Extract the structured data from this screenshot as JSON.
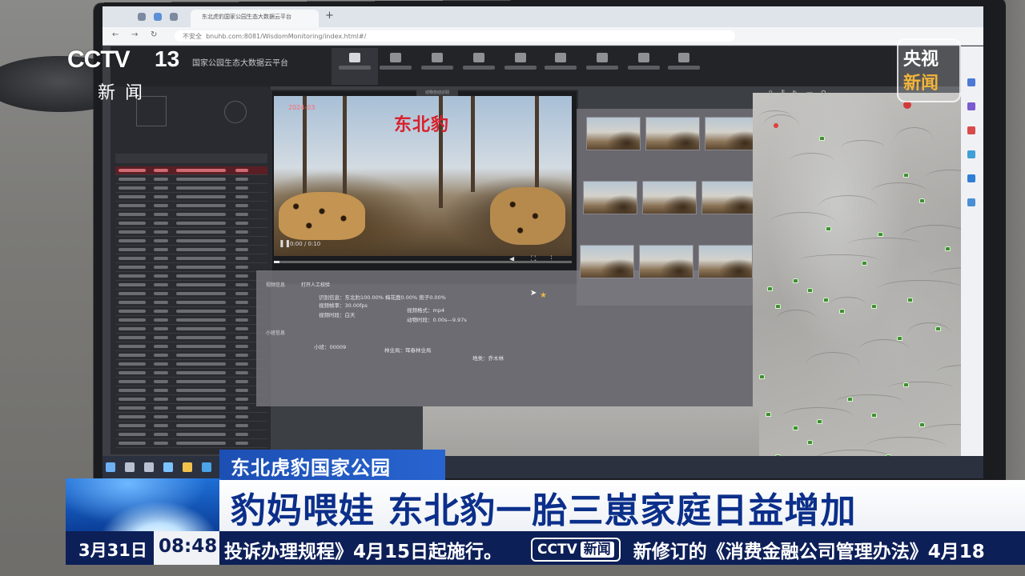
{
  "broadcast": {
    "channel_logo": "CCTV",
    "channel_number": "13",
    "channel_sub": "新闻",
    "corner_logo_top": "央视",
    "corner_logo_bottom": "新闻",
    "topic_tag": "东北虎豹国家公园",
    "headline": "豹妈喂娃 东北豹一胎三崽家庭日益增加",
    "date": "3月31日",
    "time": "08:48",
    "ticker_left": "投诉办理规程》4月15日起施行。",
    "ticker_logo_a": "CCTV",
    "ticker_logo_b": "新闻",
    "ticker_right": "新修订的《消费金融公司管理办法》4月18"
  },
  "browser": {
    "tab_title": "东北虎豹国家公园生态大数据云平台",
    "url_prefix": "不安全",
    "url": "bnuhb.com:8081/WisdomMonitoring/index.html#/"
  },
  "app": {
    "title": "国家公园生态大数据云平台",
    "video_tab": "动物自动识别"
  },
  "video": {
    "label": "东北豹",
    "timestamp": "2024-03",
    "time_display": "0:00 / 0:10",
    "progress": 0.02
  },
  "info": {
    "section_video": "视频信息",
    "manual_check_button": "打开人工校验",
    "recognition_label": "识别信息：",
    "recognition_value": "东北豹100.00%  梅花鹿0.00%  狍子0.00%",
    "fps_label": "视频帧率：",
    "fps_value": "30.00fps",
    "format_label": "视频格式：",
    "format_value": "mp4",
    "period_label": "视频时段：",
    "period_value": "白天",
    "animal_time_label": "动物时段：",
    "animal_time_value": "0.00s—9.97s",
    "section_plot": "小班信息",
    "plot_label": "小班：",
    "plot_value": "00009",
    "bureau_label": "林业局：",
    "bureau_value": "珲春林业局",
    "land_label": "地类：",
    "land_value": "乔木林"
  },
  "colors": {
    "headline_text": "#0b2f8a",
    "topic_bg": "#1c4fb3",
    "ticker_bg": "#0d1f57",
    "video_label": "#d8212c",
    "map_pin": "#3f8f33"
  }
}
